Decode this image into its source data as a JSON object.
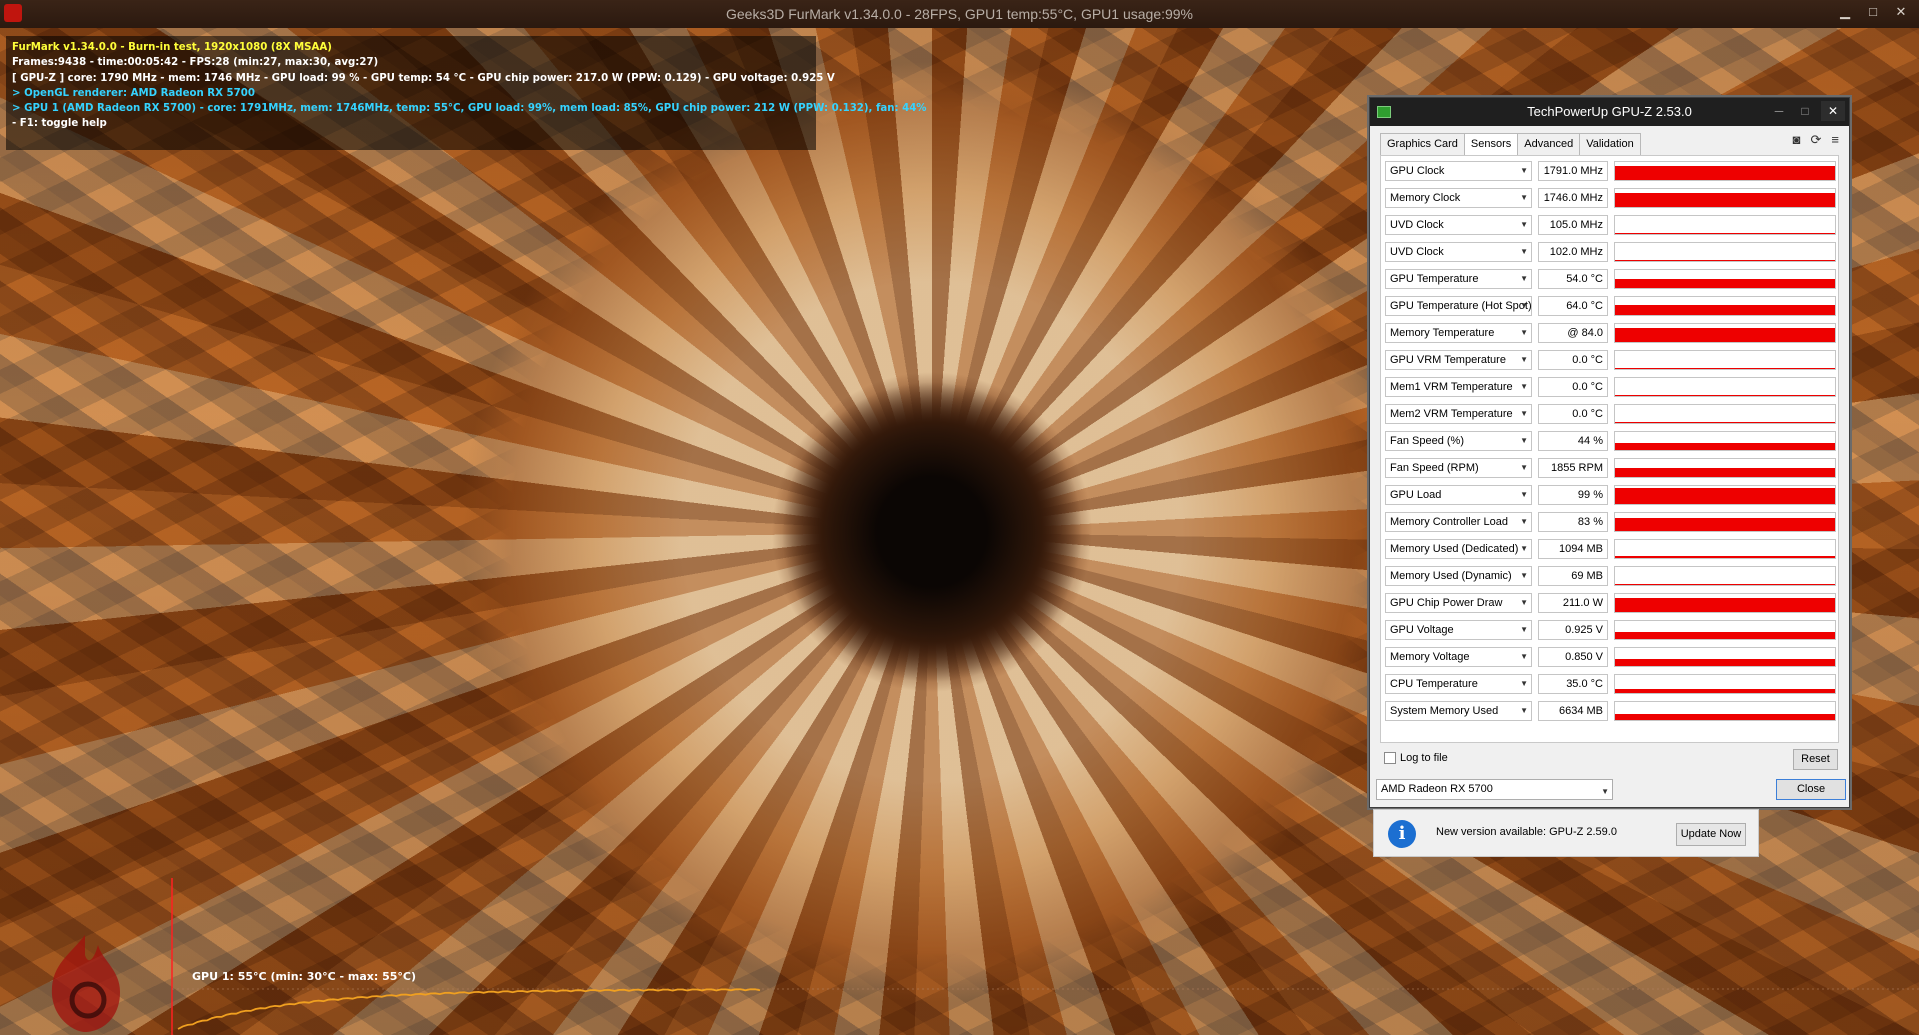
{
  "furmark": {
    "window_title": "Geeks3D FurMark v1.34.0.0 - 28FPS, GPU1 temp:55°C, GPU1 usage:99%",
    "osd": [
      {
        "text": "FurMark v1.34.0.0 - Burn-in test, 1920x1080 (8X MSAA)",
        "color": "yellow"
      },
      {
        "text": "Frames:9438 - time:00:05:42 - FPS:28 (min:27, max:30, avg:27)",
        "color": "white"
      },
      {
        "text": "[ GPU-Z ] core: 1790 MHz - mem: 1746 MHz - GPU load: 99 % - GPU temp: 54 °C - GPU chip power: 217.0 W (PPW: 0.129) - GPU voltage: 0.925 V",
        "color": "white"
      },
      {
        "text": "> OpenGL renderer: AMD Radeon RX 5700",
        "color": "cyan"
      },
      {
        "text": "> GPU 1 (AMD Radeon RX 5700) - core: 1791MHz, mem: 1746MHz, temp: 55°C, GPU load: 99%, mem load: 85%, GPU chip power: 212 W (PPW: 0.132), fan: 44%",
        "color": "cyan"
      },
      {
        "text": "- F1: toggle help",
        "color": "white"
      }
    ],
    "temp_graph_label": "GPU 1: 55°C (min: 30°C - max: 55°C)",
    "temp_graph_data": {
      "min_c": 30,
      "max_c": 55,
      "current_c": 55
    }
  },
  "gpuz": {
    "title": "TechPowerUp GPU-Z 2.53.0",
    "tabs": [
      "Graphics Card",
      "Sensors",
      "Advanced",
      "Validation"
    ],
    "active_tab": "Sensors",
    "toolbar_icons": [
      "camera-icon",
      "refresh-icon",
      "menu-icon"
    ],
    "sensors": [
      {
        "name": "GPU Clock",
        "value": "1791.0 MHz",
        "level": 0.85
      },
      {
        "name": "Memory Clock",
        "value": "1746.0 MHz",
        "level": 0.85
      },
      {
        "name": "UVD Clock",
        "value": "105.0 MHz",
        "level": 0.05
      },
      {
        "name": "UVD Clock",
        "value": "102.0 MHz",
        "level": 0.05
      },
      {
        "name": "GPU Temperature",
        "value": "54.0 °C",
        "level": 0.55
      },
      {
        "name": "GPU Temperature (Hot Spot)",
        "value": "64.0 °C",
        "level": 0.6
      },
      {
        "name": "Memory Temperature",
        "value": "@ 84.0",
        "level": 0.85
      },
      {
        "name": "GPU VRM Temperature",
        "value": "0.0 °C",
        "level": 0
      },
      {
        "name": "Mem1 VRM Temperature",
        "value": "0.0 °C",
        "level": 0
      },
      {
        "name": "Mem2 VRM Temperature",
        "value": "0.0 °C",
        "level": 0
      },
      {
        "name": "Fan Speed (%)",
        "value": "44 %",
        "level": 0.45
      },
      {
        "name": "Fan Speed (RPM)",
        "value": "1855 RPM",
        "level": 0.55
      },
      {
        "name": "GPU Load",
        "value": "99 %",
        "level": 0.99
      },
      {
        "name": "Memory Controller Load",
        "value": "83 %",
        "level": 0.83
      },
      {
        "name": "Memory Used (Dedicated)",
        "value": "1094 MB",
        "level": 0.15
      },
      {
        "name": "Memory Used (Dynamic)",
        "value": "69 MB",
        "level": 0.05
      },
      {
        "name": "GPU Chip Power Draw",
        "value": "211.0 W",
        "level": 0.9
      },
      {
        "name": "GPU Voltage",
        "value": "0.925 V",
        "level": 0.45
      },
      {
        "name": "Memory Voltage",
        "value": "0.850 V",
        "level": 0.45
      },
      {
        "name": "CPU Temperature",
        "value": "35.0 °C",
        "level": 0.25
      },
      {
        "name": "System Memory Used",
        "value": "6634 MB",
        "level": 0.35
      }
    ],
    "log_to_file": "Log to file",
    "reset": "Reset",
    "device": "AMD Radeon RX 5700",
    "close": "Close",
    "update": {
      "text": "New version available: GPU-Z 2.59.0",
      "button": "Update Now"
    }
  },
  "colors": {
    "sensor_bar": "#ee0000",
    "osd_yellow": "#ffff3a",
    "osd_cyan": "#35d3ff",
    "graph_line": "#f0a020"
  }
}
